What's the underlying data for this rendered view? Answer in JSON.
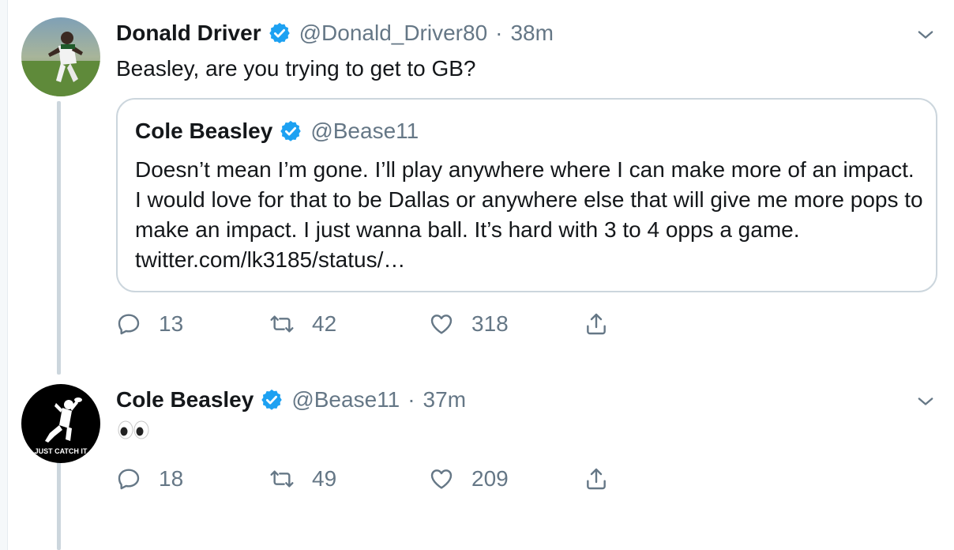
{
  "tweets": [
    {
      "name": "Donald Driver",
      "handle": "@Donald_Driver80",
      "separator": "·",
      "time": "38m",
      "text": "Beasley, are you trying to get to GB?",
      "quote": {
        "name": "Cole Beasley",
        "handle": "@Bease11",
        "text": "Doesn’t mean I’m gone. I’ll play anywhere where I can make more of an impact. I would love for that to be Dallas or anywhere else that will give me more pops to make an impact. I just wanna ball. It’s hard with 3 to 4 opps a game. twitter.com/lk3185/status/…"
      },
      "replies": "13",
      "retweets": "42",
      "likes": "318"
    },
    {
      "name": "Cole Beasley",
      "handle": "@Bease11",
      "separator": "·",
      "time": "37m",
      "text": "👀",
      "avatar_caption": "JUST CATCH IT",
      "replies": "18",
      "retweets": "49",
      "likes": "209"
    }
  ],
  "icons": {
    "verified": "verified-badge-icon",
    "caret": "chevron-down-icon",
    "reply": "reply-icon",
    "retweet": "retweet-icon",
    "like": "heart-icon",
    "share": "share-icon"
  },
  "colors": {
    "verified_blue": "#1da1f2",
    "secondary_text": "#657786",
    "thread_line": "#ccd6dd"
  }
}
